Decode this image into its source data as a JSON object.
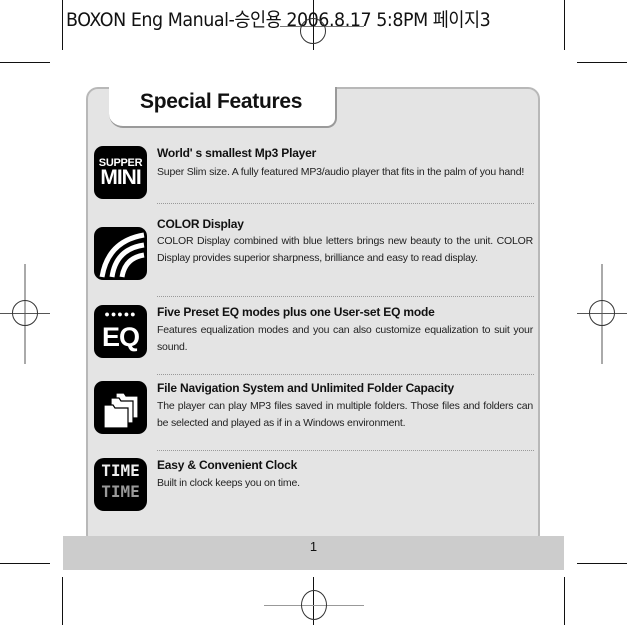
{
  "print_header": {
    "text": "BOXON Eng Manual-승인용  2006.8.17 5:8PM 페이지3"
  },
  "page": {
    "title": "Special Features",
    "page_number": "1"
  },
  "features": [
    {
      "icon": "supper-mini-icon",
      "icon_text_top": "SUPPER",
      "icon_text_bottom": "MINI",
      "title": "World' s smallest Mp3 Player",
      "description": "Super Slim size. A fully featured MP3/audio player that fits in the palm of you hand!"
    },
    {
      "icon": "color-display-icon",
      "title": "COLOR Display",
      "description": "COLOR Display combined with blue letters brings new beauty to the unit. COLOR Display provides superior sharpness, brilliance and easy to read display."
    },
    {
      "icon": "eq-icon",
      "icon_text_top": "●●●●●",
      "icon_text_bottom": "EQ",
      "title": "Five Preset EQ modes plus one User-set EQ mode",
      "description": "Features equalization modes and you can also customize equalization to suit your sound."
    },
    {
      "icon": "folders-icon",
      "title": "File Navigation System and Unlimited Folder Capacity",
      "description": "The player can play MP3 files saved in multiple folders. Those files and folders can be selected and played as if in a Windows environment."
    },
    {
      "icon": "clock-time-icon",
      "icon_text_top": "TIME",
      "icon_text_bottom": "TIME",
      "title": "Easy & Convenient Clock",
      "description": "Built in clock keeps you on time."
    }
  ]
}
